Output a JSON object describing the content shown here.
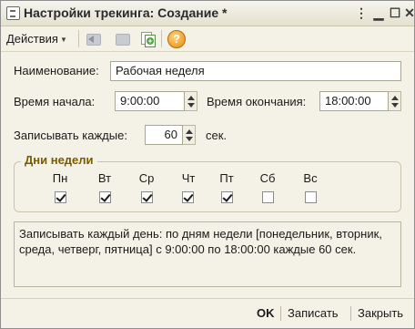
{
  "window": {
    "title": "Настройки трекинга: Создание *"
  },
  "toolbar": {
    "actions_label": "Действия"
  },
  "form": {
    "name_label": "Наименование:",
    "name_value": "Рабочая неделя",
    "start_label": "Время начала:",
    "start_value": "9:00:00",
    "end_label": "Время окончания:",
    "end_value": "18:00:00",
    "interval_label": "Записывать каждые:",
    "interval_value": "60",
    "interval_unit": "сек."
  },
  "weekdays": {
    "group_title": "Дни недели",
    "days": [
      {
        "label": "Пн",
        "checked": true
      },
      {
        "label": "Вт",
        "checked": true
      },
      {
        "label": "Ср",
        "checked": true
      },
      {
        "label": "Чт",
        "checked": true
      },
      {
        "label": "Пт",
        "checked": true
      },
      {
        "label": "Сб",
        "checked": false
      },
      {
        "label": "Вс",
        "checked": false
      }
    ]
  },
  "description": "Записывать каждый день: по дням недели [понедельник, вторник, среда, четверг, пятница] с 9:00:00 по 18:00:00 каждые 60 сек.",
  "footer": {
    "ok_label": "OK",
    "save_label": "Записать",
    "close_label": "Закрыть"
  },
  "icons": {
    "window": "form-icon",
    "toolbar": [
      "go-back-icon",
      "hierarchy-icon",
      "copy-add-icon",
      "help-icon"
    ]
  }
}
